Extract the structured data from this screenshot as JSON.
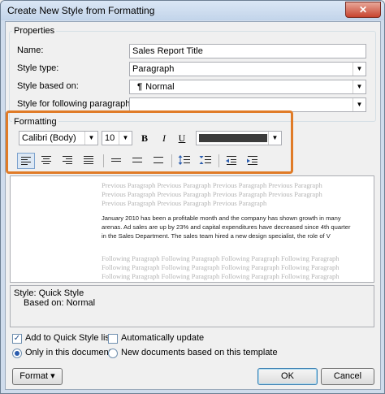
{
  "window": {
    "title": "Create New Style from Formatting",
    "close_glyph": "✕"
  },
  "properties": {
    "group_label": "Properties",
    "name_label": "Name:",
    "name_value": "Sales Report Title",
    "style_type_label": "Style type:",
    "style_type_value": "Paragraph",
    "based_on_label": "Style based on:",
    "based_on_value": "Normal",
    "following_label": "Style for following paragraph:",
    "following_value": ""
  },
  "formatting": {
    "group_label": "Formatting",
    "font": "Calibri (Body)",
    "size": "10",
    "bold": "B",
    "italic": "I",
    "underline": "U",
    "color": "#3c3c3c"
  },
  "preview": {
    "previous_line1": "Previous Paragraph Previous Paragraph Previous Paragraph Previous Paragraph",
    "previous_line2": "Previous Paragraph Previous Paragraph Previous Paragraph Previous Paragraph",
    "previous_line3": "Previous Paragraph Previous Paragraph Previous Paragraph",
    "main_text": "January 2010 has been a profitable month and the company has shown growth in many arenas. Ad sales are up by 23% and capital expenditures have decreased since 4th quarter in the Sales Department. The sales team hired a new design specialist, the role of V",
    "following_line1": "Following Paragraph Following Paragraph Following Paragraph Following Paragraph",
    "following_line2": "Following Paragraph Following Paragraph Following Paragraph Following Paragraph",
    "following_line3": "Following Paragraph Following Paragraph Following Paragraph Following Paragraph"
  },
  "description": {
    "line1": "Style: Quick Style",
    "line2": "Based on: Normal"
  },
  "options": {
    "add_quick_style": "Add to Quick Style list",
    "add_quick_style_checked": true,
    "auto_update": "Automatically update",
    "auto_update_checked": false,
    "only_this_doc": "Only in this document",
    "new_docs": "New documents based on this template"
  },
  "buttons": {
    "format": "Format ▾",
    "ok": "OK",
    "cancel": "Cancel"
  }
}
